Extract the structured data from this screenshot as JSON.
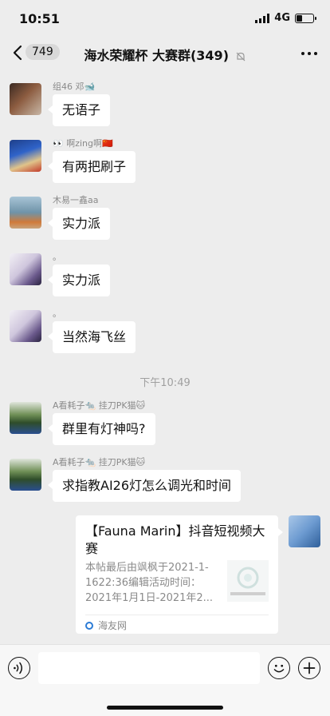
{
  "status": {
    "time": "10:51",
    "network": "4G",
    "battery_level": 0.35
  },
  "nav": {
    "back_count": "749",
    "title": "海水荣耀杯 大赛群(349)",
    "icons": {
      "back": "chevron-left-icon",
      "mute": "bell-off-icon",
      "more": "more-dots-icon"
    }
  },
  "messages": [
    {
      "sender": "组46 邓🐋",
      "text": "无语子"
    },
    {
      "sender": "👀 啊zing啊🇨🇳",
      "text": "有两把刷子"
    },
    {
      "sender": "木易一鑫aa",
      "text": "实力派"
    },
    {
      "sender": "。",
      "text": "实力派"
    },
    {
      "sender": "。",
      "text": "当然海飞丝"
    },
    {
      "sender": "A看耗子🐀 挂刀PK猫🐱",
      "text": "群里有灯神吗?"
    },
    {
      "sender": "A看耗子🐀 挂刀PK猫🐱",
      "text": "求指教AI26灯怎么调光和时间"
    }
  ],
  "time_divider": "下午10:49",
  "shared_card": {
    "title": "【Fauna Marin】抖音短视频大赛",
    "description": "本帖最后由飒枫于2021-1-1622:36编辑活动时间：2021年1月1日-2021年2...",
    "source": "海友网"
  },
  "input_bar": {
    "placeholder": "",
    "icons": {
      "voice": "voice-icon",
      "emoji": "emoji-icon",
      "plus": "plus-icon"
    }
  },
  "colors": {
    "background": "#ededed",
    "bubble": "#ffffff",
    "meta_text": "#8a8a8a"
  }
}
